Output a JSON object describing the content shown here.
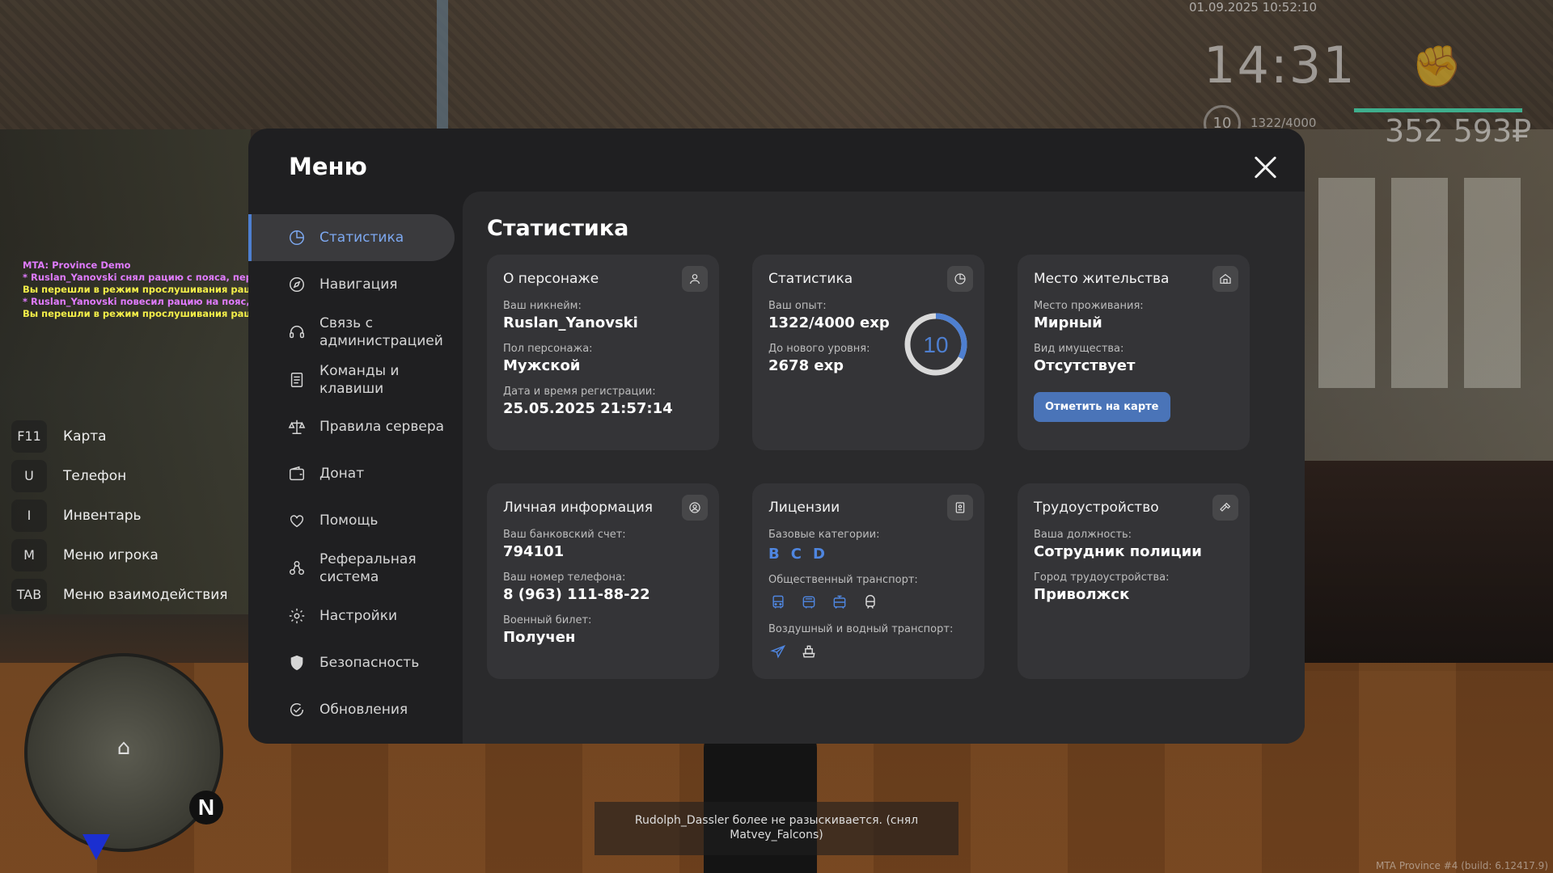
{
  "hud": {
    "datetime": "01.09.2025 10:52:10",
    "time": "14:31",
    "level": "10",
    "exp": "1322/4000",
    "money": "352 593₽",
    "build": "MTA Province #4 (build: 6.12417.9)"
  },
  "chat": [
    {
      "text": "MTA: Province Demo",
      "color": "pink"
    },
    {
      "text": "* Ruslan_Yanovski снял рацию с пояса, перевел ее в режим прослушивания",
      "color": "pink"
    },
    {
      "text": "Вы перешли в режим прослушивания рации.",
      "color": "yellow"
    },
    {
      "text": "* Ruslan_Yanovski повесил рацию на пояс, отжав кнопку",
      "color": "pink"
    },
    {
      "text": "Вы перешли в режим прослушивания рации.",
      "color": "yellow"
    }
  ],
  "keybinds": [
    {
      "key": "F11",
      "label": "Карта"
    },
    {
      "key": "U",
      "label": "Телефон"
    },
    {
      "key": "I",
      "label": "Инвентарь"
    },
    {
      "key": "M",
      "label": "Меню игрока"
    },
    {
      "key": "TAB",
      "label": "Меню взаимодействия"
    }
  ],
  "minimap": {
    "north": "N"
  },
  "notice": "Rudolph_Dassler более не разыскивается. (снял Matvey_Falcons)",
  "menu": {
    "title": "Меню",
    "sidebar": [
      {
        "label": "Статистика",
        "icon": "pie-chart-icon",
        "active": true
      },
      {
        "label": "Навигация",
        "icon": "compass-icon"
      },
      {
        "label": "Связь с администрацией",
        "icon": "headset-icon"
      },
      {
        "label": "Команды и клавиши",
        "icon": "document-icon"
      },
      {
        "label": "Правила сервера",
        "icon": "scales-icon"
      },
      {
        "label": "Донат",
        "icon": "wallet-icon"
      },
      {
        "label": "Помощь",
        "icon": "heart-hand-icon"
      },
      {
        "label": "Реферальная система",
        "icon": "referral-icon"
      },
      {
        "label": "Настройки",
        "icon": "gear-icon"
      },
      {
        "label": "Безопасность",
        "icon": "shield-icon"
      },
      {
        "label": "Обновления",
        "icon": "update-check-icon"
      }
    ],
    "content_title": "Статистика",
    "cards": {
      "character": {
        "title": "О персонаже",
        "nickname_label": "Ваш никнейм:",
        "nickname": "Ruslan_Yanovski",
        "gender_label": "Пол персонажа:",
        "gender": "Мужской",
        "reg_label": "Дата и время регистрации:",
        "reg": "25.05.2025 21:57:14"
      },
      "stats": {
        "title": "Статистика",
        "exp_label": "Ваш опыт:",
        "exp": "1322/4000 exp",
        "next_label": "До нового уровня:",
        "next": "2678 exp",
        "level": "10",
        "progress": 0.33
      },
      "residence": {
        "title": "Место жительства",
        "place_label": "Место проживания:",
        "place": "Мирный",
        "property_label": "Вид имущества:",
        "property": "Отсутствует",
        "button": "Отметить на карте"
      },
      "personal": {
        "title": "Личная информация",
        "bank_label": "Ваш банковский счет:",
        "bank": "794101",
        "phone_label": "Ваш номер телефона:",
        "phone": "8 (963) 111-88-22",
        "military_label": "Военный билет:",
        "military": "Получен"
      },
      "licenses": {
        "title": "Лицензии",
        "base_label": "Базовые категории:",
        "base": [
          "B",
          "C",
          "D"
        ],
        "public_label": "Общественный транспорт:",
        "public_icons": [
          "bus-icon",
          "trolleybus-icon",
          "tram-icon",
          "subway-icon"
        ],
        "air_label": "Воздушный и водный транспорт:",
        "air_icons": [
          "plane-icon",
          "ship-icon"
        ]
      },
      "job": {
        "title": "Трудоустройство",
        "position_label": "Ваша должность:",
        "position": "Сотрудник полиции",
        "city_label": "Город трудоустройства:",
        "city": "Приволжск"
      }
    }
  },
  "colors": {
    "accent": "#4e7fd0",
    "panel": "#1f1f21",
    "content": "#2a2a2c",
    "card": "#343437"
  }
}
